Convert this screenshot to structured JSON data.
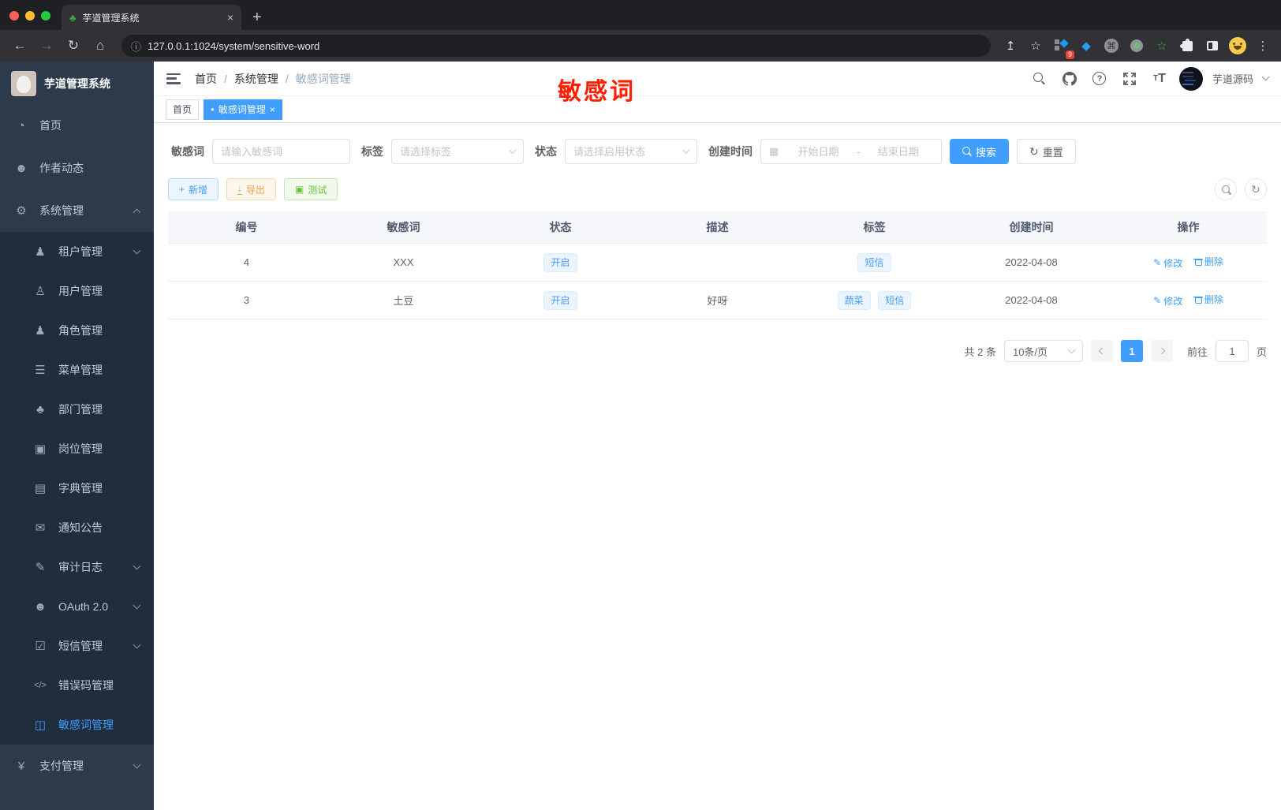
{
  "browser": {
    "tab_title": "芋道管理系统",
    "close_tab": "×",
    "new_tab": "+",
    "url": "127.0.0.1:1024/system/sensitive-word",
    "extension_badge": "9"
  },
  "icons": {
    "favicon": "♣",
    "back": "←",
    "forward": "→",
    "reload": "↻",
    "home": "⌂",
    "info": "ⓘ",
    "share": "↥",
    "star": "☆",
    "command": "⌘",
    "kebab": "⋮",
    "gem": "◆",
    "green_star": "☆",
    "plus": "+",
    "download": "↓",
    "doc": "▣",
    "calendar": "▦",
    "refresh": "↻",
    "edit": "✎",
    "dot": "●",
    "close": "×",
    "question": "?",
    "font_small": "T",
    "font_big": "T",
    "caret_down": "▾"
  },
  "sidebar": {
    "app_title": "芋道管理系统",
    "items": [
      {
        "label": "首页",
        "icon": "◔"
      },
      {
        "label": "作者动态",
        "icon": "☻"
      },
      {
        "label": "系统管理",
        "icon": "⚙"
      },
      {
        "label": "租户管理",
        "icon": "♟"
      },
      {
        "label": "用户管理",
        "icon": "♙"
      },
      {
        "label": "角色管理",
        "icon": "♟"
      },
      {
        "label": "菜单管理",
        "icon": "☰"
      },
      {
        "label": "部门管理",
        "icon": "♣"
      },
      {
        "label": "岗位管理",
        "icon": "▣"
      },
      {
        "label": "字典管理",
        "icon": "▤"
      },
      {
        "label": "通知公告",
        "icon": "✉"
      },
      {
        "label": "审计日志",
        "icon": "✎"
      },
      {
        "label": "OAuth 2.0",
        "icon": "☻"
      },
      {
        "label": "短信管理",
        "icon": "☑"
      },
      {
        "label": "错误码管理",
        "icon": "</>"
      },
      {
        "label": "敏感词管理",
        "icon": "◫"
      },
      {
        "label": "支付管理",
        "icon": "¥"
      }
    ]
  },
  "header": {
    "breadcrumb": [
      "首页",
      "系统管理",
      "敏感词管理"
    ],
    "breadcrumb_sep": "/",
    "annotation": "敏感词",
    "user_name": "芋道源码"
  },
  "tags_view": {
    "tabs": [
      {
        "label": "首页"
      },
      {
        "label": "敏感词管理"
      }
    ]
  },
  "filters": {
    "keyword_label": "敏感词",
    "keyword_placeholder": "请输入敏感词",
    "tag_label": "标签",
    "tag_placeholder": "请选择标签",
    "status_label": "状态",
    "status_placeholder": "请选择启用状态",
    "time_label": "创建时间",
    "start_placeholder": "开始日期",
    "range_sep": "-",
    "end_placeholder": "结束日期",
    "search_label": "搜索",
    "reset_label": "重置"
  },
  "toolbar": {
    "add_label": "新增",
    "export_label": "导出",
    "test_label": "测试"
  },
  "table": {
    "headers": [
      "编号",
      "敏感词",
      "状态",
      "描述",
      "标签",
      "创建时间",
      "操作"
    ],
    "rows": [
      {
        "id": "4",
        "word": "XXX",
        "status": "开启",
        "description": "",
        "tags": [
          "短信"
        ],
        "create_time": "2022-04-08",
        "edit_label": "修改",
        "delete_label": "删除"
      },
      {
        "id": "3",
        "word": "土豆",
        "status": "开启",
        "description": "好呀",
        "tags": [
          "蔬菜",
          "短信"
        ],
        "create_time": "2022-04-08",
        "edit_label": "修改",
        "delete_label": "删除"
      }
    ]
  },
  "pagination": {
    "total_text": "共 2 条",
    "page_size": "10条/页",
    "current_page": "1",
    "goto_label": "前往",
    "goto_value": "1",
    "page_suffix": "页"
  },
  "colors": {
    "accent": "#409eff",
    "annotation_red": "#ff1f02",
    "warning": "#e6a23c",
    "success": "#67c23a",
    "sidebar_bg": "#2d3a4b",
    "submenu_bg": "#1f2d3d"
  }
}
